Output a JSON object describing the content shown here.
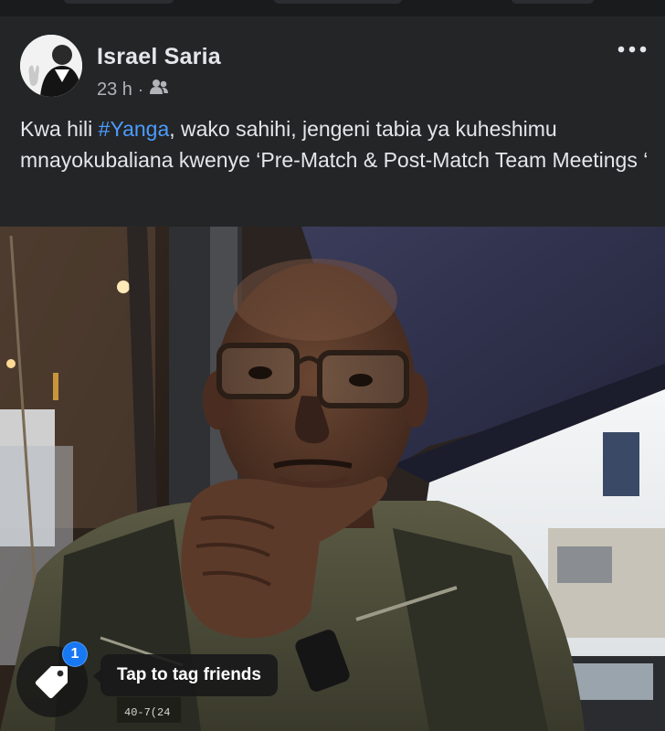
{
  "post": {
    "author_name": "Israel Saria",
    "time": "23 h",
    "separator": "·",
    "audience_icon": "friends-icon",
    "more_icon": "more-horizontal-icon",
    "text_before_hashtag": "Kwa hili ",
    "hashtag": "#Yanga",
    "text_after_hashtag": ", wako sahihi, jengeni tabia ya kuheshimu mnayokubaliana kwenye ‘Pre-Match & Post-Match Team Meetings ‘"
  },
  "photo": {
    "tag_icon": "tag-icon",
    "tag_badge_count": "1",
    "tag_prompt": "Tap to tag friends",
    "jacket_text": "40-7(24"
  },
  "colors": {
    "card_background": "#242526",
    "hashtag": "#4b9cff",
    "badge": "#1877f2"
  }
}
